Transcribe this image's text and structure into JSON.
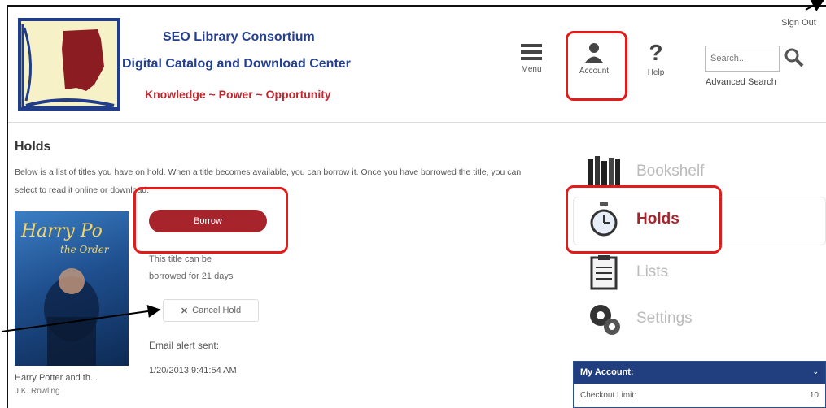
{
  "header": {
    "brand_line_1": "SEO Library Consortium",
    "brand_line_2": "Digital Catalog and Download Center",
    "tagline": "Knowledge ~ Power ~ Opportunity",
    "nav": {
      "menu": "Menu",
      "account": "Account",
      "help": "Help"
    },
    "search_placeholder": "Search...",
    "advanced_search": "Advanced Search",
    "sign_out": "Sign Out"
  },
  "content": {
    "title": "Holds",
    "description": "Below is a list of titles you have on hold. When a title becomes available, you can borrow it. Once you have borrowed the title, you can select to read it online or download.",
    "item": {
      "cover_title": "Harry Po",
      "cover_subtitle": "the Order",
      "title": "Harry Potter and th...",
      "author": "J.K. Rowling",
      "borrow_label": "Borrow",
      "borrow_note_1": "This title can be",
      "borrow_note_2": "borrowed for 21 days",
      "cancel_label": "Cancel Hold",
      "email_label": "Email alert sent:",
      "email_date": "1/20/2013 9:41:54 AM"
    }
  },
  "sidebar": {
    "items": [
      {
        "label": "Bookshelf",
        "icon": "bookshelf-icon"
      },
      {
        "label": "Holds",
        "icon": "stopwatch-icon",
        "active": true
      },
      {
        "label": "Lists",
        "icon": "clipboard-icon"
      },
      {
        "label": "Settings",
        "icon": "gear-icon"
      }
    ],
    "account": {
      "header": "My Account:",
      "row_label": "Checkout Limit:",
      "row_value": "10"
    }
  },
  "colors": {
    "brand_blue": "#24408f",
    "brand_red": "#a7242d",
    "highlight": "#e31b1b",
    "panel_blue": "#213f7e"
  }
}
